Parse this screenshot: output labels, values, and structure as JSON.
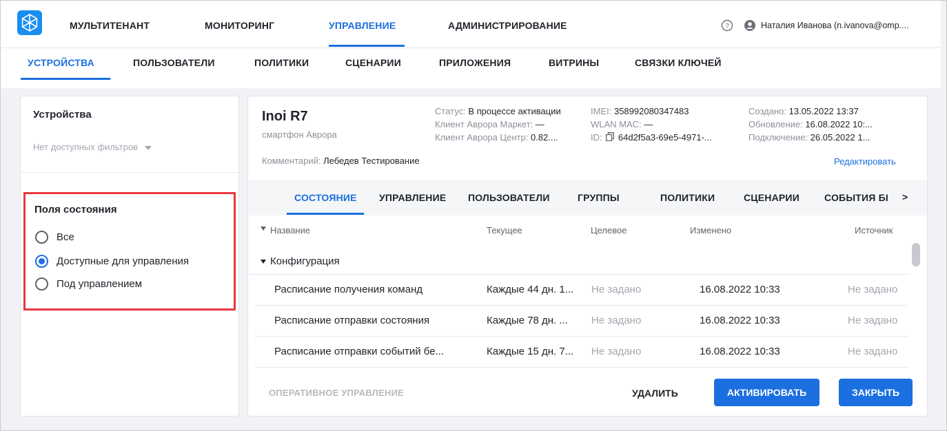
{
  "topnav": {
    "items": [
      "МУЛЬТИТЕНАНТ",
      "МОНИТОРИНГ",
      "УПРАВЛЕНИЕ",
      "АДМИНИСТРИРОВАНИЕ"
    ],
    "active": "УПРАВЛЕНИЕ",
    "user_name": "Наталия Иванова (n.ivanova@omp...."
  },
  "subnav": {
    "items": [
      "УСТРОЙСТВА",
      "ПОЛЬЗОВАТЕЛИ",
      "ПОЛИТИКИ",
      "СЦЕНАРИИ",
      "ПРИЛОЖЕНИЯ",
      "ВИТРИНЫ",
      "СВЯЗКИ КЛЮЧЕЙ"
    ],
    "active": "УСТРОЙСТВА"
  },
  "left_panel": {
    "title": "Устройства",
    "filter_placeholder": "Нет доступных фильтров",
    "state_fields": {
      "title": "Поля состояния",
      "options": [
        "Все",
        "Доступные для управления",
        "Под управлением"
      ],
      "selected": "Доступные для управления"
    }
  },
  "device": {
    "name": "Inoi R7",
    "type": "смартфон Аврора",
    "comment_label": "Комментарий:",
    "comment": "Лебедев Тестирование",
    "status_label": "Статус:",
    "status": "В процессе активации",
    "client_market_label": "Клиент Аврора Маркет:",
    "client_market": "—",
    "client_center_label": "Клиент Аврора Центр:",
    "client_center": "0.82....",
    "imei_label": "IMEI:",
    "imei": "358992080347483",
    "wlan_label": "WLAN MAC:",
    "wlan": "—",
    "id_label": "ID:",
    "id": "64d2f5a3-69e5-4971-...",
    "created_label": "Создано:",
    "created": "13.05.2022 13:37",
    "updated_label": "Обновление:",
    "updated": "16.08.2022 10:...",
    "connected_label": "Подключение:",
    "connected": "26.05.2022 1...",
    "edit_label": "Редактировать"
  },
  "tabs": {
    "items": [
      "СОСТОЯНИЕ",
      "УПРАВЛЕНИЕ",
      "ПОЛЬЗОВАТЕЛИ",
      "ГРУППЫ",
      "ПОЛИТИКИ",
      "СЦЕНАРИИ",
      "СОБЫТИЯ БІ"
    ],
    "active": "СОСТОЯНИЕ",
    "more": ">"
  },
  "table": {
    "headers": [
      "Название",
      "Текущее",
      "Целевое",
      "Изменено",
      "Источник"
    ],
    "group": "Конфигурация",
    "rows": [
      [
        "Расписание получения команд",
        "Каждые 44 дн. 1...",
        "Не задано",
        "16.08.2022 10:33",
        "Не задано"
      ],
      [
        "Расписание отправки состояния",
        "Каждые 78 дн. ...",
        "Не задано",
        "16.08.2022 10:33",
        "Не задано"
      ],
      [
        "Расписание отправки событий бе...",
        "Каждые 15 дн. 7...",
        "Не задано",
        "16.08.2022 10:33",
        "Не задано"
      ]
    ]
  },
  "footer": {
    "operative": "ОПЕРАТИВНОЕ УПРАВЛЕНИЕ",
    "delete": "УДАЛИТЬ",
    "activate": "АКТИВИРОВАТЬ",
    "close": "ЗАКРЫТЬ"
  },
  "colors": {
    "accent": "#1b6fe0",
    "highlight_border": "#e8393f",
    "muted_text": "#a2a7af"
  },
  "icons": [
    "app-logo-icon",
    "help-icon",
    "user-icon",
    "dropdown-arrow-icon",
    "copy-icon",
    "chevron-right-icon",
    "caret-down-icon"
  ]
}
